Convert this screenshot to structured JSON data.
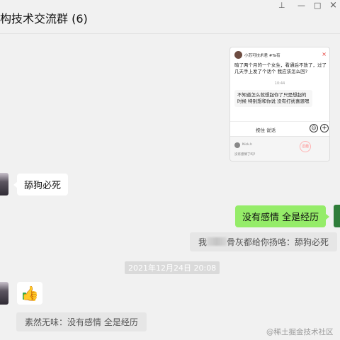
{
  "window": {
    "title": "构技术交流群 (6)",
    "pin_glyph": "⊥",
    "minimize_glyph": "—",
    "restore_glyph": "□",
    "close_glyph": "×"
  },
  "shared_screenshot": {
    "author": "小苏可技术君 #Ta有",
    "close_glyph": "×",
    "post": "暗了两个月的一个女生，看通后不放了，过了几天手上发了个话个 我应该怎么回?",
    "time": "10:44",
    "reply": "不知道怎么就想起你了只是想起的时候 特别想和你说 没有打扰喜恩嗯",
    "bar_label": "按住 说话",
    "emoji_glyph": "☺",
    "plus_glyph": "+",
    "panel_name": "Nick.h",
    "panel_sub": "没有感情了吗?",
    "watermark": "逗趣"
  },
  "messages": [
    {
      "text": "舔狗必死"
    },
    {
      "text": "没有感情   全是经历"
    },
    {
      "quote_prefix": "我",
      "quote_suffix": "骨灰都给你扬咯：舔狗必死"
    },
    {
      "text": "👍"
    },
    {
      "quote": "素然无味：没有感情   全是经历"
    }
  ],
  "timestamp": "2021年12月24日 20:08",
  "watermark": "@稀土掘金技术社区",
  "colors": {
    "outgoing_bubble": "#95ec69",
    "incoming_bubble": "#ffffff",
    "background": "#f1f1f1"
  }
}
